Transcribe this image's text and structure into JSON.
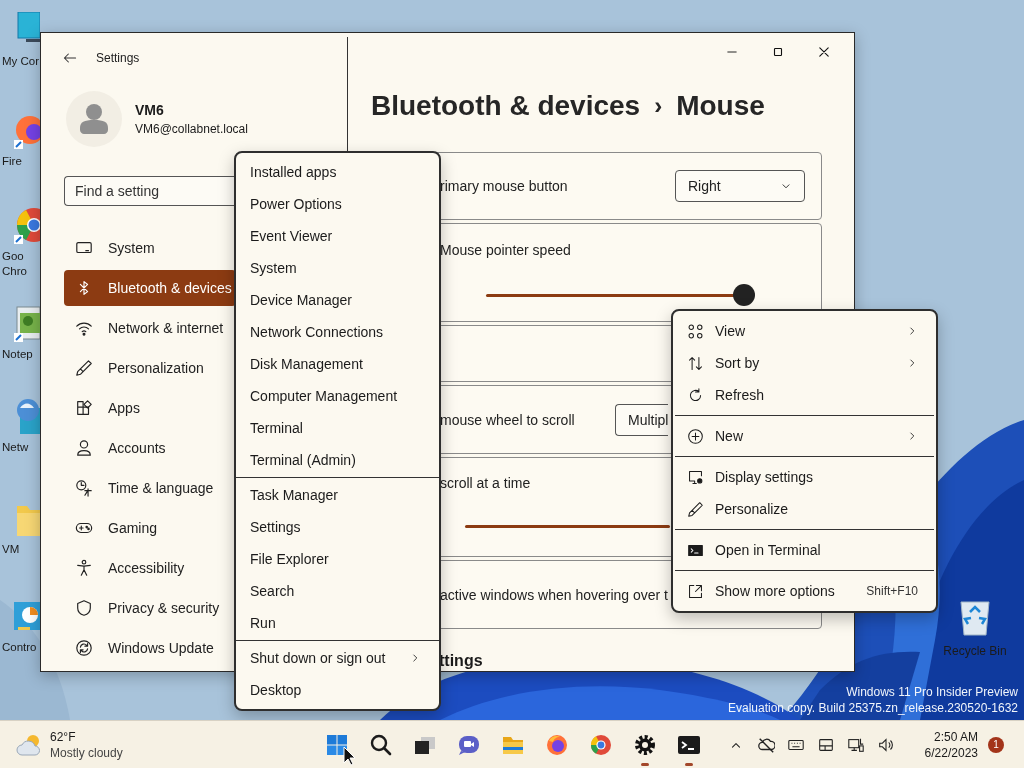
{
  "desktop_icons": [
    {
      "label": "My Cor"
    },
    {
      "label": "Fire"
    },
    {
      "label": "Goo\nChro"
    },
    {
      "label": "Notep"
    },
    {
      "label": "Netw"
    },
    {
      "label": "VM"
    },
    {
      "label": "Contro"
    }
  ],
  "recycle_bin": {
    "label": "Recycle Bin"
  },
  "evaluation_notice": [
    "Windows 11 Pro Insider Preview",
    "Evaluation copy. Build 25375.zn_release.230520-1632"
  ],
  "settings_window": {
    "title": "Settings",
    "user": {
      "name": "VM6",
      "email": "VM6@collabnet.local"
    },
    "search": {
      "placeholder": "Find a setting"
    },
    "nav": [
      {
        "label": "System",
        "selected": false
      },
      {
        "label": "Bluetooth & devices",
        "selected": true
      },
      {
        "label": "Network & internet",
        "selected": false
      },
      {
        "label": "Personalization",
        "selected": false
      },
      {
        "label": "Apps",
        "selected": false
      },
      {
        "label": "Accounts",
        "selected": false
      },
      {
        "label": "Time & language",
        "selected": false
      },
      {
        "label": "Gaming",
        "selected": false
      },
      {
        "label": "Accessibility",
        "selected": false
      },
      {
        "label": "Privacy & security",
        "selected": false
      },
      {
        "label": "Windows Update",
        "selected": false
      }
    ],
    "breadcrumb": {
      "parent": "Bluetooth & devices",
      "separator": "›",
      "current": "Mouse"
    },
    "cards": [
      {
        "kind": "dropdown",
        "label": "rimary mouse button",
        "value": "Right"
      },
      {
        "kind": "slider",
        "label": "Mouse pointer speed",
        "level": 1
      },
      {
        "kind": "empty"
      },
      {
        "kind": "dropdown",
        "label": "mouse wheel to scroll",
        "value": "Multipl"
      },
      {
        "kind": "track",
        "label": "scroll at a time"
      },
      {
        "kind": "text",
        "label": "active windows when hovering over t"
      }
    ],
    "section_heading": "ttings"
  },
  "quick_link_menu": {
    "groups": [
      [
        {
          "label": "Installed apps",
          "submenu": false
        },
        {
          "label": "Power Options",
          "submenu": false
        },
        {
          "label": "Event Viewer",
          "submenu": false
        },
        {
          "label": "System",
          "submenu": false
        },
        {
          "label": "Device Manager",
          "submenu": false
        },
        {
          "label": "Network Connections",
          "submenu": false
        },
        {
          "label": "Disk Management",
          "submenu": false
        },
        {
          "label": "Computer Management",
          "submenu": false
        },
        {
          "label": "Terminal",
          "submenu": false
        },
        {
          "label": "Terminal (Admin)",
          "submenu": false
        }
      ],
      [
        {
          "label": "Task Manager",
          "submenu": false
        },
        {
          "label": "Settings",
          "submenu": false
        },
        {
          "label": "File Explorer",
          "submenu": false
        },
        {
          "label": "Search",
          "submenu": false
        },
        {
          "label": "Run",
          "submenu": false
        }
      ],
      [
        {
          "label": "Shut down or sign out",
          "submenu": true
        },
        {
          "label": "Desktop",
          "submenu": false
        }
      ]
    ]
  },
  "desktop_menu": {
    "groups": [
      [
        {
          "label": "View",
          "submenu": true
        },
        {
          "label": "Sort by",
          "submenu": true
        },
        {
          "label": "Refresh",
          "submenu": false
        }
      ],
      [
        {
          "label": "New",
          "submenu": true
        }
      ],
      [
        {
          "label": "Display settings",
          "submenu": false
        },
        {
          "label": "Personalize",
          "submenu": false
        }
      ],
      [
        {
          "label": "Open in Terminal",
          "submenu": false
        }
      ],
      [
        {
          "label": "Show more options",
          "submenu": false,
          "shortcut": "Shift+F10"
        }
      ]
    ]
  },
  "taskbar": {
    "weather": {
      "temperature": "62°F",
      "condition": "Mostly cloudy"
    },
    "apps": [
      {
        "running": false
      },
      {
        "running": false
      },
      {
        "running": false
      },
      {
        "running": false
      },
      {
        "running": false
      },
      {
        "running": false
      },
      {
        "running": false
      },
      {
        "running": true
      },
      {
        "running": true
      }
    ],
    "clock": {
      "time": "2:50 AM",
      "date": "6/22/2023"
    },
    "notifications": "1"
  }
}
